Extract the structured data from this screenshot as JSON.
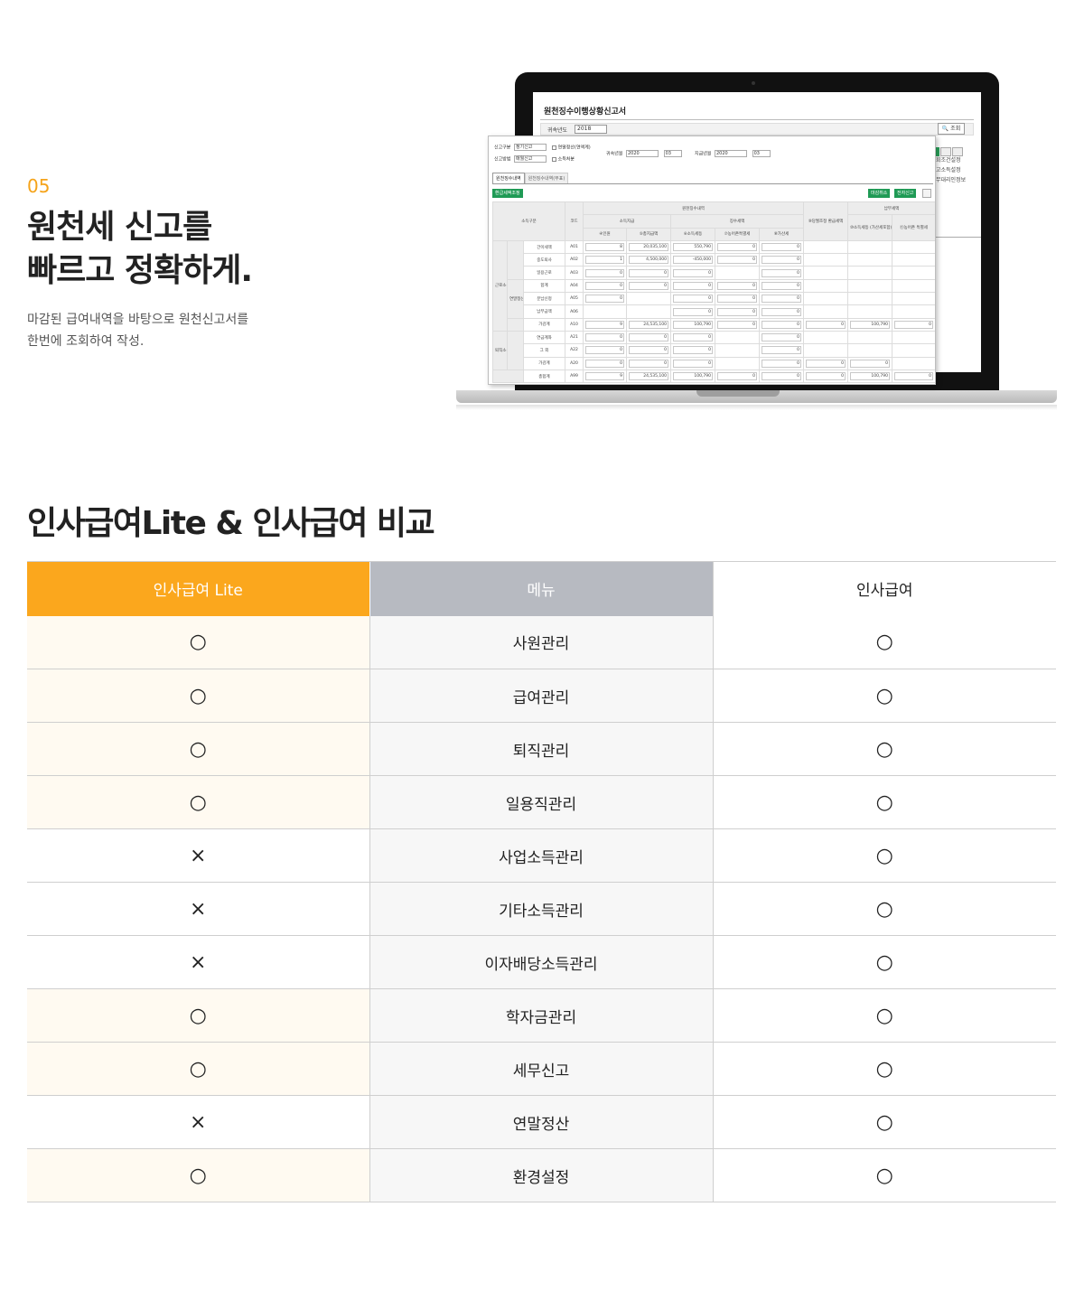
{
  "hero": {
    "step": "05",
    "title_line1": "원천세 신고를",
    "title_line2": "빠르고 정확하게.",
    "desc_line1": "마감된 급여내역을 바탕으로 원천신고서를",
    "desc_line2": "한번에 조회하여 작성."
  },
  "back_window": {
    "title": "원천징수이행상황신고서",
    "year_label": "귀속년도",
    "year_value": "2018",
    "search_button": "조회",
    "side_items": [
      "회조건설정",
      "고소득설정",
      "무대리인정보"
    ]
  },
  "front_window": {
    "report_type_label": "신고구분",
    "report_type_value": "정기신고",
    "yearend_check": "연말정산(연액계)",
    "report_method_label": "신고방법",
    "report_method_value": "매월신고",
    "income_check": "소득처분",
    "belong_label": "귀속년월",
    "belong_year": "2020",
    "belong_month": "03",
    "pay_label": "지급년월",
    "pay_year": "2020",
    "pay_month": "03",
    "tab_active": "원천징수내역",
    "tab_inactive": "원천징수내역(부표)",
    "btn_refund": "환급세액조정",
    "btn_cancel": "마감취소",
    "btn_efile": "전자신고",
    "headers": {
      "income_type": "소득구분",
      "code": "코드",
      "withholding": "원천징수내역",
      "income_paid": "소득지급",
      "income_paid_sub": "(과세미달,일부비과세포함)",
      "people": "④인원",
      "total_paid": "⑤총지급액",
      "tax_collected": "징수세액",
      "income_tax": "⑥소득세등",
      "rural_tax": "⑦농어촌특별세",
      "add_tax": "⑧가산세",
      "adjust": "⑨당월조정 환급세액",
      "payment": "납부세액",
      "pay_income_tax": "⑩소득세등 (가산세포함)",
      "pay_rural_tax": "⑪농어촌 특별세"
    },
    "rows": [
      {
        "name": "간이세액",
        "code": "A01",
        "people": "8",
        "total": "20,035,100",
        "tax": "550,790",
        "rural": "0",
        "add": "0",
        "adj": "",
        "pay": "",
        "pay_rural": ""
      },
      {
        "name": "중도퇴사",
        "code": "A02",
        "people": "1",
        "total": "4,500,000",
        "tax": "-450,000",
        "rural": "0",
        "add": "0",
        "adj": "",
        "pay": "",
        "pay_rural": ""
      },
      {
        "name": "일용근로",
        "code": "A03",
        "people": "0",
        "total": "0",
        "tax": "0",
        "rural": "",
        "add": "0",
        "adj": "",
        "pay": "",
        "pay_rural": ""
      },
      {
        "name": "합계",
        "code": "A04",
        "people": "0",
        "total": "0",
        "tax": "0",
        "rural": "0",
        "add": "0",
        "adj": "",
        "pay": "",
        "pay_rural": ""
      },
      {
        "name": "분납신청",
        "code": "A05",
        "people": "0",
        "total": "",
        "tax": "0",
        "rural": "0",
        "add": "0",
        "adj": "",
        "pay": "",
        "pay_rural": ""
      },
      {
        "name": "납부금액",
        "code": "A06",
        "people": "",
        "total": "",
        "tax": "0",
        "rural": "0",
        "add": "0",
        "adj": "",
        "pay": "",
        "pay_rural": ""
      },
      {
        "name": "가감계",
        "code": "A10",
        "people": "9",
        "total": "24,535,100",
        "tax": "100,790",
        "rural": "0",
        "add": "0",
        "adj": "0",
        "pay": "100,790",
        "pay_rural": "0"
      },
      {
        "name": "연금계좌",
        "code": "A21",
        "people": "0",
        "total": "0",
        "tax": "0",
        "rural": "",
        "add": "0",
        "adj": "",
        "pay": "",
        "pay_rural": ""
      },
      {
        "name": "그 외",
        "code": "A22",
        "people": "0",
        "total": "0",
        "tax": "0",
        "rural": "",
        "add": "0",
        "adj": "",
        "pay": "",
        "pay_rural": ""
      },
      {
        "name": "가감계",
        "code": "A20",
        "people": "0",
        "total": "0",
        "tax": "0",
        "rural": "",
        "add": "0",
        "adj": "0",
        "pay": "0",
        "pay_rural": ""
      },
      {
        "name": "총합계",
        "code": "A99",
        "people": "9",
        "total": "24,535,100",
        "tax": "100,790",
        "rural": "0",
        "add": "0",
        "adj": "0",
        "pay": "100,790",
        "pay_rural": "0"
      }
    ],
    "group_labor": "근로소득",
    "group_yearend": "연말정산",
    "group_retire": "퇴직소득"
  },
  "compare": {
    "title": "인사급여Lite & 인사급여  비교",
    "col_lite": "인사급여 Lite",
    "col_menu": "메뉴",
    "col_full": "인사급여",
    "rows": [
      {
        "menu": "사원관리",
        "lite": "○",
        "full": "○"
      },
      {
        "menu": "급여관리",
        "lite": "○",
        "full": "○"
      },
      {
        "menu": "퇴직관리",
        "lite": "○",
        "full": "○"
      },
      {
        "menu": "일용직관리",
        "lite": "○",
        "full": "○"
      },
      {
        "menu": "사업소득관리",
        "lite": "×",
        "full": "○"
      },
      {
        "menu": "기타소득관리",
        "lite": "×",
        "full": "○"
      },
      {
        "menu": "이자배당소득관리",
        "lite": "×",
        "full": "○"
      },
      {
        "menu": "학자금관리",
        "lite": "○",
        "full": "○"
      },
      {
        "menu": "세무신고",
        "lite": "○",
        "full": "○"
      },
      {
        "menu": "연말정산",
        "lite": "×",
        "full": "○"
      },
      {
        "menu": "환경설정",
        "lite": "○",
        "full": "○"
      }
    ]
  }
}
